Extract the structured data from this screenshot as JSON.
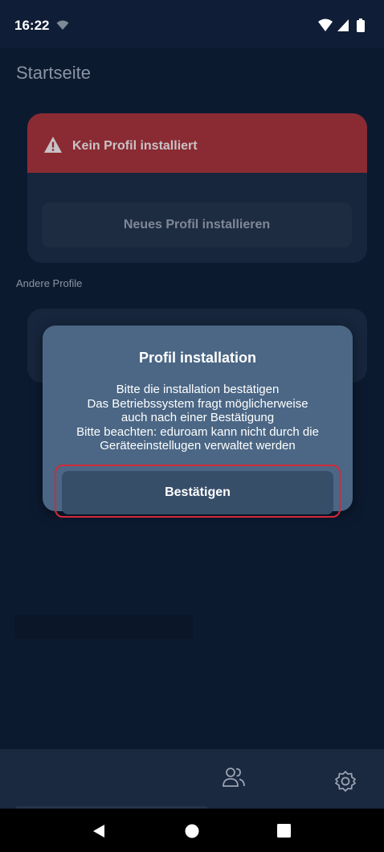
{
  "status_bar": {
    "time": "16:22",
    "icons": [
      "wifi-icon",
      "signal-icon",
      "battery-icon"
    ]
  },
  "page": {
    "title": "Startseite"
  },
  "profile_card": {
    "status_text": "Kein Profil installiert",
    "status_icon": "warning-icon",
    "install_button_label": "Neues Profil installieren"
  },
  "other_profiles": {
    "label": "Andere Profile"
  },
  "dialog": {
    "title": "Profil installation",
    "lines": [
      "Bitte die installation bestätigen",
      "Das Betriebssystem fragt möglicherweise",
      "auch nach einer Bestätigung",
      "Bitte beachten: eduroam kann nicht durch die",
      "Geräteeinstellugen verwaltet werden"
    ],
    "confirm_label": "Bestätigen"
  },
  "bottom_nav": {
    "items": [
      "people-icon",
      "settings-icon"
    ]
  },
  "system_nav": {
    "items": [
      "back-icon",
      "home-icon",
      "recents-icon"
    ]
  },
  "colors": {
    "background": "#0c1a30",
    "error_header": "#8a2b33",
    "dialog": "#4b6785",
    "confirm_button": "#374e69",
    "highlight": "#d22a3a"
  }
}
